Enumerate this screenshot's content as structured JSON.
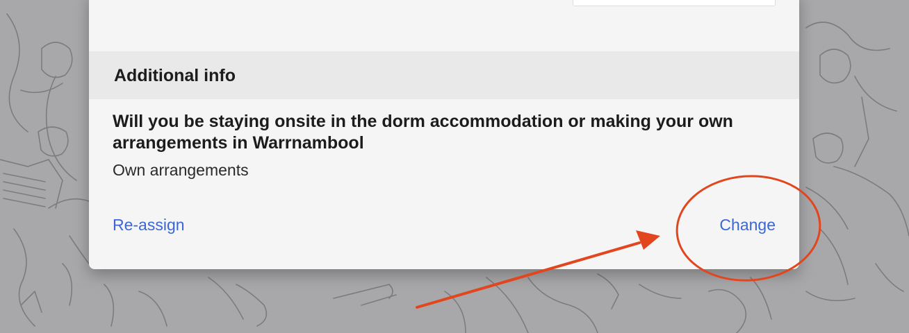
{
  "section": {
    "title": "Additional info"
  },
  "question": {
    "text": "Will you be staying onsite in the dorm accommodation or making your own arrangements in Warrnambool",
    "answer": "Own arrangements"
  },
  "actions": {
    "reassign_label": "Re-assign",
    "change_label": "Change"
  },
  "colors": {
    "link": "#3b67d6",
    "annotation": "#e2461f",
    "backdrop": "#a9a9ab",
    "card": "#f5f5f5",
    "header_band": "#e9e9e9"
  },
  "annotations": {
    "highlight": "red-circle-around-change",
    "pointer": "red-arrow-pointing-to-change"
  }
}
